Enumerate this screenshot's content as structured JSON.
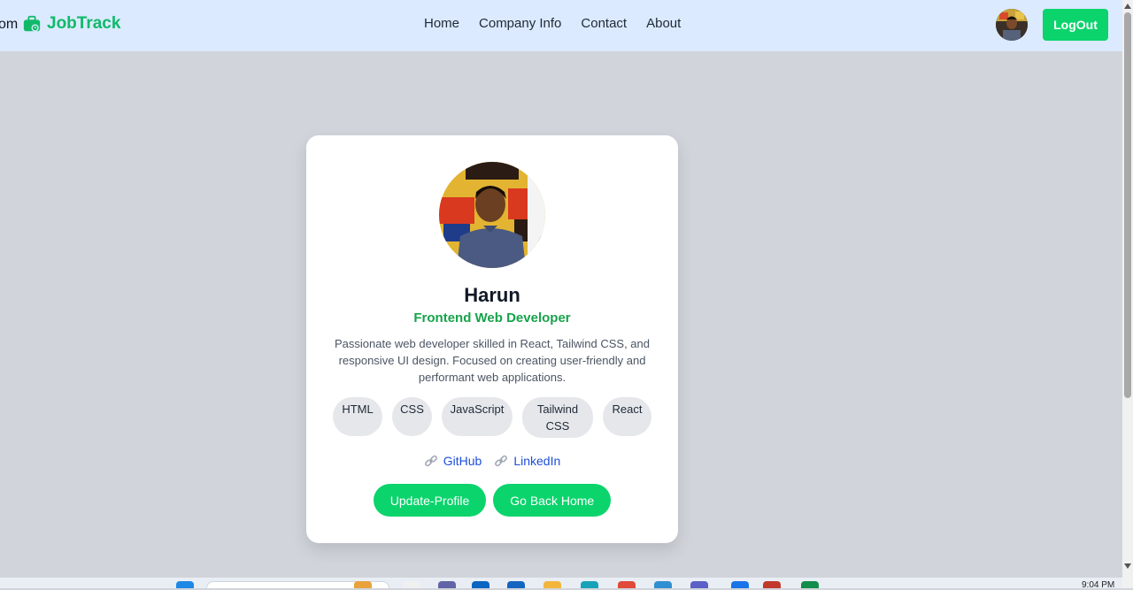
{
  "navbar": {
    "brand_prefix": "om",
    "brand_name": "JobTrack",
    "links": [
      "Home",
      "Company Info",
      "Contact",
      "About"
    ],
    "logout_label": "LogOut"
  },
  "profile": {
    "name": "Harun",
    "role": "Frontend Web Developer",
    "bio": "Passionate web developer skilled in React, Tailwind CSS, and responsive UI design. Focused on creating user-friendly and performant web applications.",
    "skills": [
      "HTML",
      "CSS",
      "JavaScript",
      "Tailwind CSS",
      "React"
    ],
    "links": [
      {
        "label": "GitHub",
        "icon": "link-icon"
      },
      {
        "label": "LinkedIn",
        "icon": "link-icon"
      }
    ],
    "update_button": "Update-Profile",
    "home_button": "Go Back Home"
  },
  "taskbar": {
    "clock": "9:04 PM"
  },
  "colors": {
    "accent": "#0bd46c",
    "navbar_bg": "#dbeafe",
    "page_bg": "#d1d5db",
    "role_text": "#16a34a",
    "link_text": "#1d4ed8"
  }
}
